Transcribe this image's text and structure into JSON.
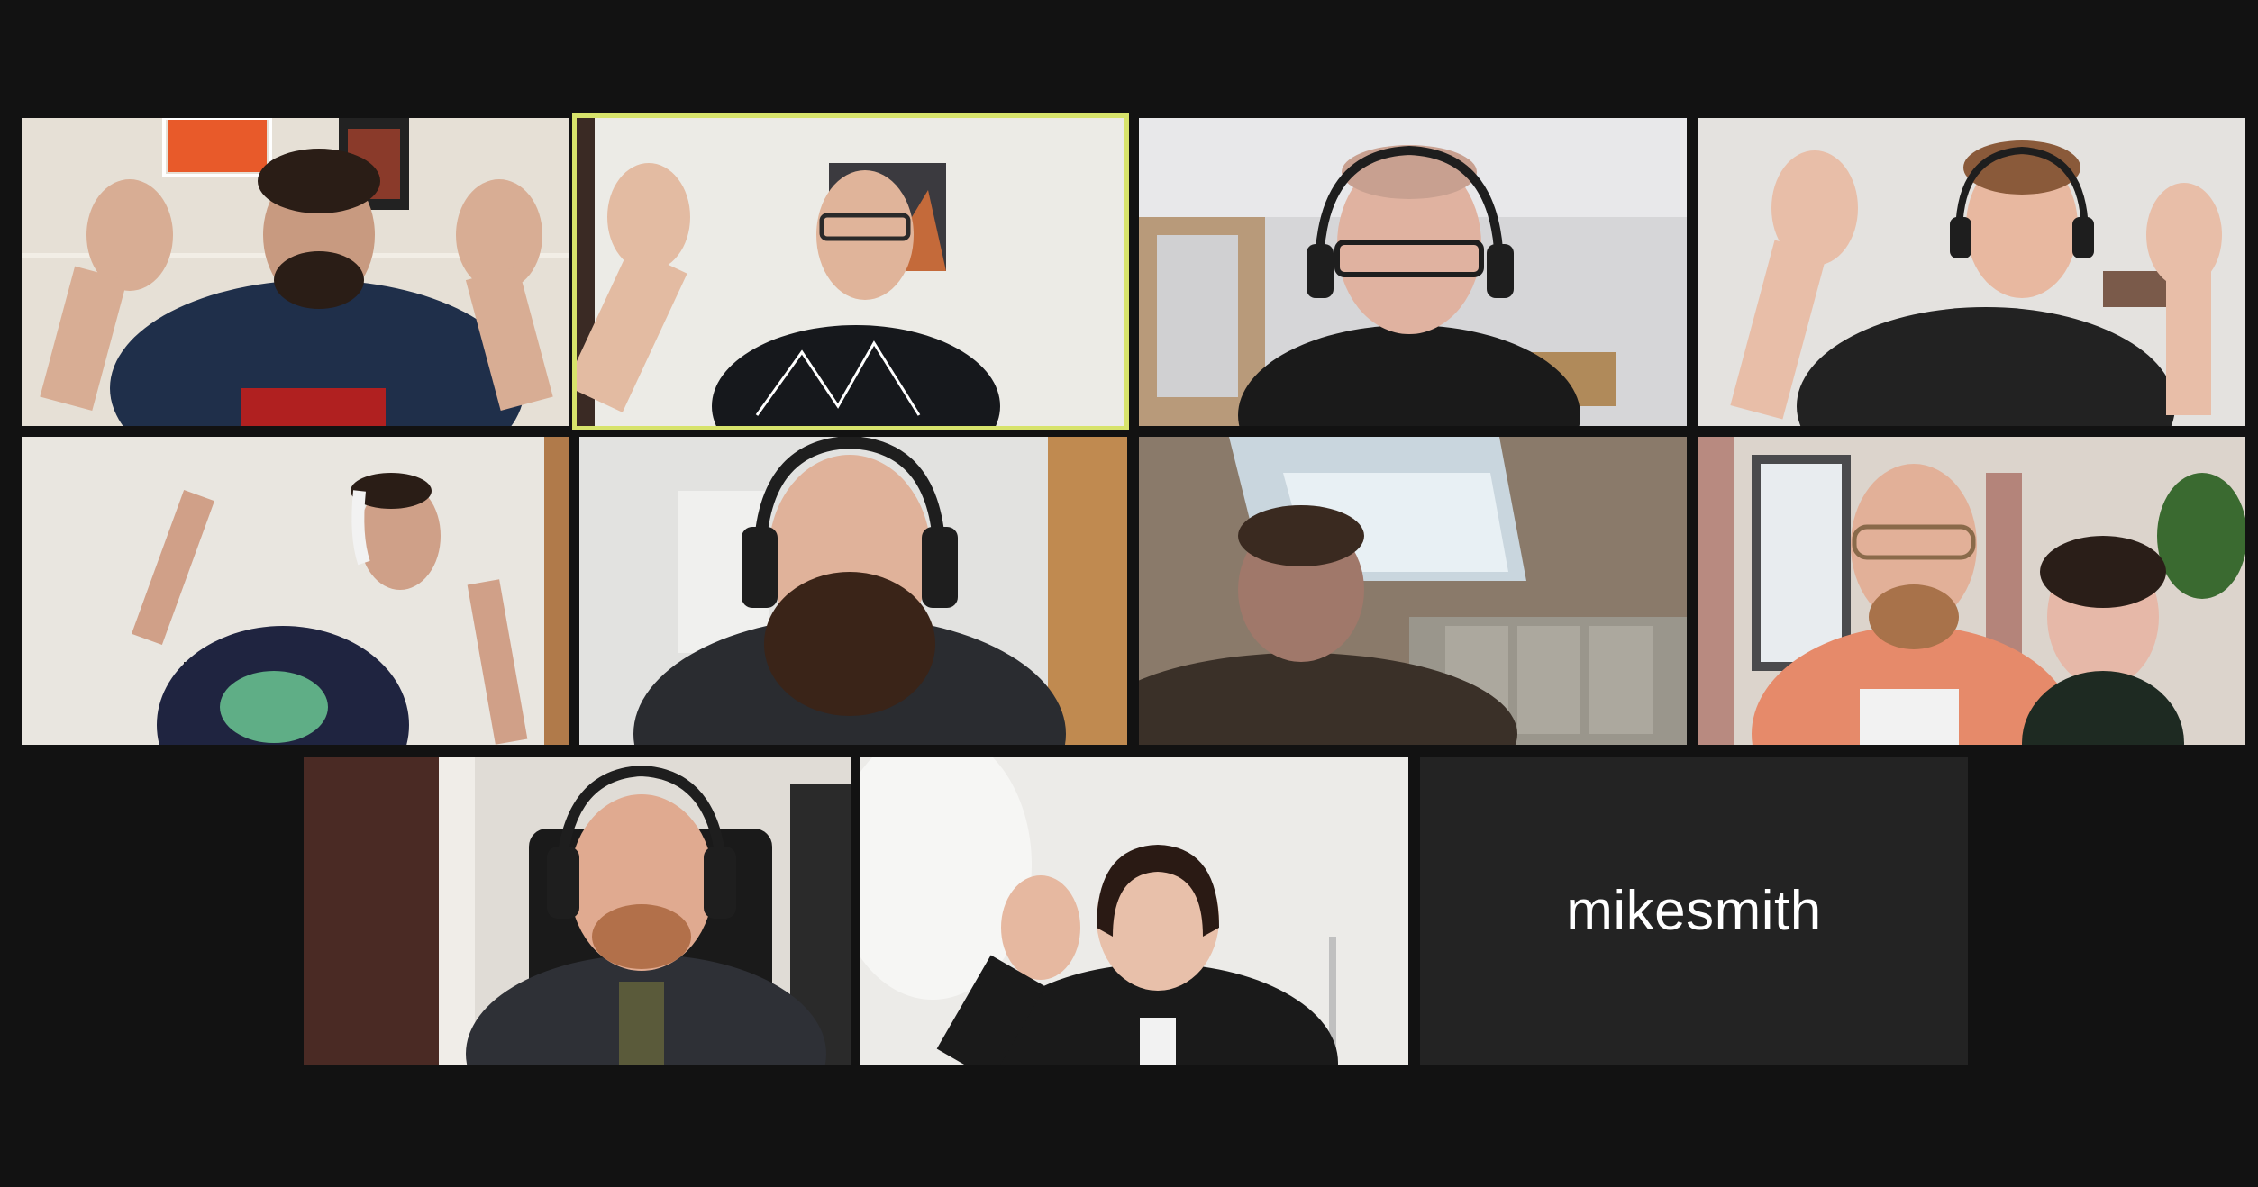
{
  "meeting": {
    "layout": "gallery-view",
    "active_speaker_color": "#d7e36b"
  },
  "participants": [
    {
      "video": "on"
    },
    {
      "video": "on",
      "active_speaker": true
    },
    {
      "video": "on"
    },
    {
      "video": "on"
    },
    {
      "video": "on"
    },
    {
      "video": "on"
    },
    {
      "video": "on"
    },
    {
      "video": "on"
    },
    {
      "video": "on"
    },
    {
      "video": "on"
    },
    {
      "video": "off",
      "display_name": "mikesmith"
    }
  ]
}
